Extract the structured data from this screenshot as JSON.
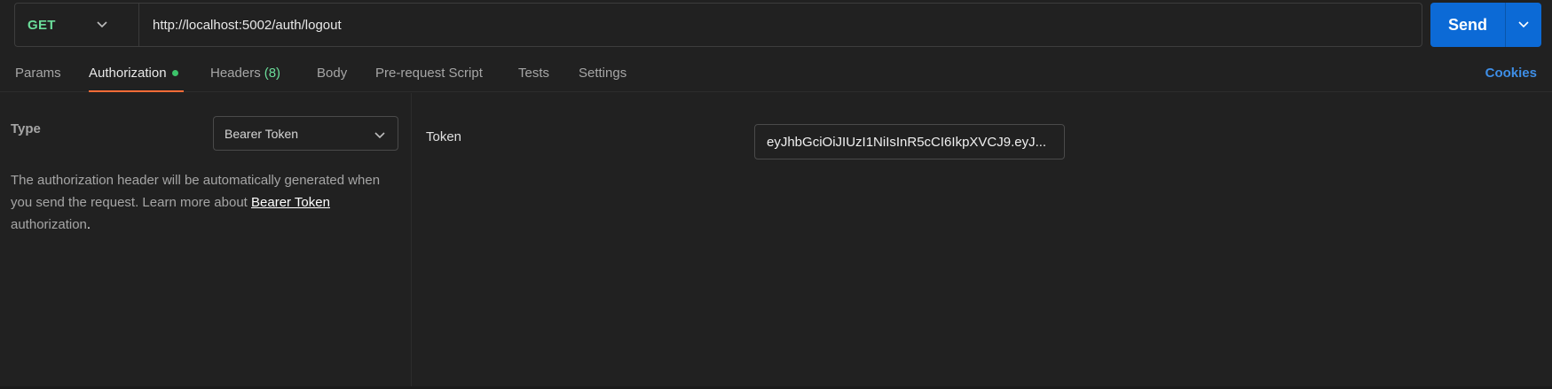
{
  "request": {
    "method": "GET",
    "url": "http://localhost:5002/auth/logout",
    "send_label": "Send"
  },
  "tabs": [
    {
      "label": "Params"
    },
    {
      "label": "Authorization",
      "active": true,
      "has_dot": true
    },
    {
      "label": "Headers",
      "count": "(8)"
    },
    {
      "label": "Body"
    },
    {
      "label": "Pre-request Script"
    },
    {
      "label": "Tests"
    },
    {
      "label": "Settings"
    }
  ],
  "cookies_label": "Cookies",
  "auth": {
    "type_label": "Type",
    "type_value": "Bearer Token",
    "description_part1": "The authorization header will be automatically generated when you send the request. Learn more about ",
    "description_link": "Bearer Token",
    "description_part2": " authorization",
    "description_end": ".",
    "token_label": "Token",
    "token_value": "eyJhbGciOiJIUzI1NiIsInR5cCI6IkpXVCJ9.eyJ..."
  },
  "colors": {
    "background": "#212121",
    "method_get": "#6bdd9a",
    "send_button": "#0c6ad6",
    "active_tab_underline": "#ff6c37",
    "cookies_link": "#3e8ee6",
    "status_dot": "#3cc36a"
  }
}
